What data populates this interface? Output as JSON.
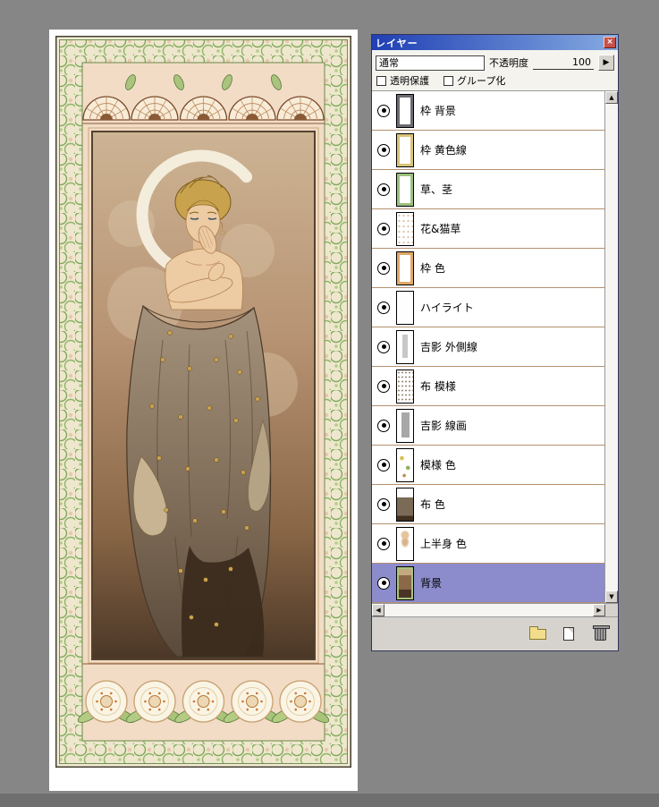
{
  "window": {
    "background": "#868686"
  },
  "canvas": {
    "alt": "Art Nouveau style illustration: blond figure draped in patterned cloth in front of a crescent moon, inside an ornate floral frame"
  },
  "palette": {
    "title": "レイヤー",
    "close_glyph": "×",
    "blend_mode": {
      "value": "通常"
    },
    "opacity": {
      "label": "不透明度",
      "value": "100"
    },
    "panel_arrow_glyph": "▶",
    "checkboxes": [
      {
        "label": "透明保護",
        "checked": false
      },
      {
        "label": "グループ化",
        "checked": false
      }
    ],
    "layers": [
      {
        "name": "枠 背景",
        "visible": true,
        "selected": false,
        "thumb": "frame-dark"
      },
      {
        "name": "枠 黄色線",
        "visible": true,
        "selected": false,
        "thumb": "frame-tan"
      },
      {
        "name": "草、茎",
        "visible": true,
        "selected": false,
        "thumb": "frame-green"
      },
      {
        "name": "花&猫草",
        "visible": true,
        "selected": false,
        "thumb": "dots-light"
      },
      {
        "name": "枠 色",
        "visible": true,
        "selected": false,
        "thumb": "frame-orange"
      },
      {
        "name": "ハイライト",
        "visible": true,
        "selected": false,
        "thumb": "white"
      },
      {
        "name": "吉影 外側線",
        "visible": true,
        "selected": false,
        "thumb": "outline"
      },
      {
        "name": "布 模様",
        "visible": true,
        "selected": false,
        "thumb": "pattern"
      },
      {
        "name": "吉影 線画",
        "visible": true,
        "selected": false,
        "thumb": "lineart"
      },
      {
        "name": "模様 色",
        "visible": true,
        "selected": false,
        "thumb": "spots"
      },
      {
        "name": "布 色",
        "visible": true,
        "selected": false,
        "thumb": "cloth"
      },
      {
        "name": "上半身 色",
        "visible": true,
        "selected": false,
        "thumb": "skin"
      },
      {
        "name": "背景",
        "visible": true,
        "selected": true,
        "thumb": "full"
      }
    ],
    "scroll": {
      "up": "▲",
      "down": "▼",
      "left": "◀",
      "right": "▶"
    },
    "colors": {
      "selection": "#8c8ccc",
      "titlebar_left": "#1f3fb4",
      "titlebar_right": "#85aae0",
      "close_button": "#c75048"
    }
  }
}
